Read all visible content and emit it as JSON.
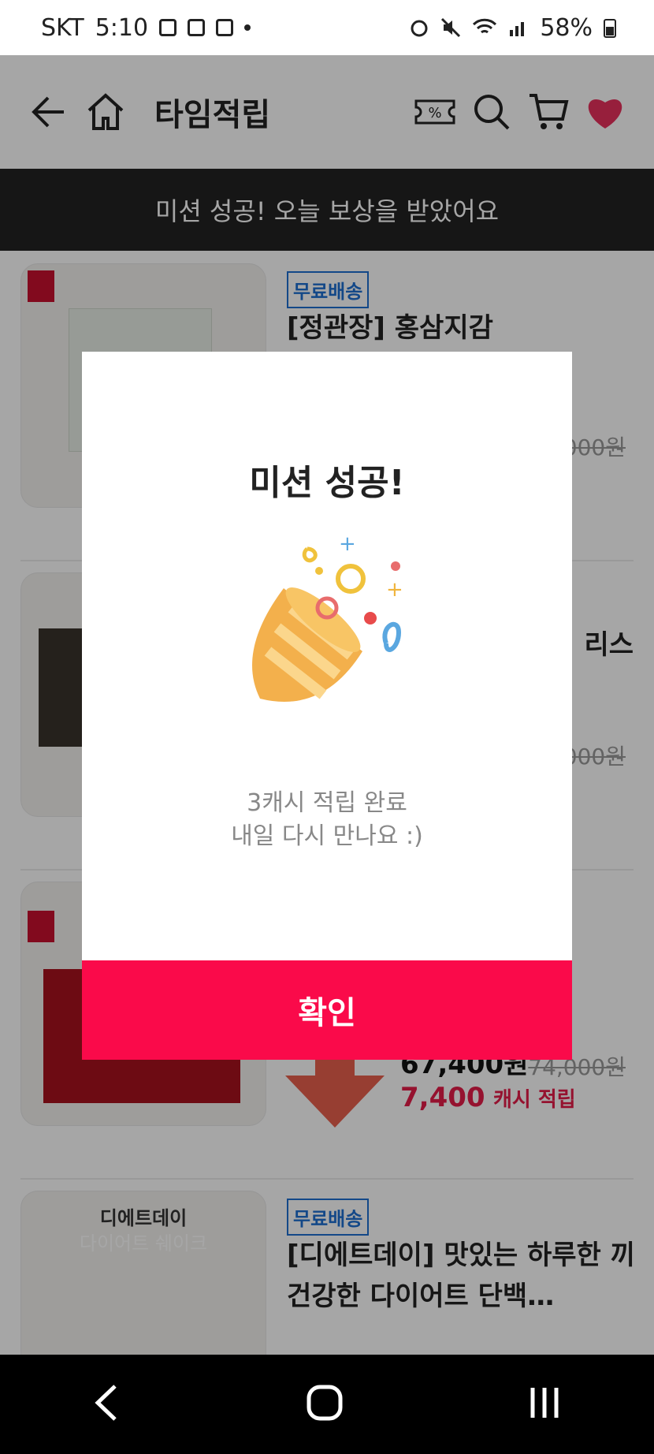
{
  "status_bar": {
    "carrier": "SKT",
    "time": "5:10",
    "battery": "58%"
  },
  "app_bar": {
    "title": "타임적립",
    "icons": [
      "back-arrow-icon",
      "home-icon",
      "coupon-icon",
      "search-icon",
      "cart-icon",
      "heart-icon"
    ]
  },
  "banner": {
    "text": "미션 성공! 오늘 보상을 받았어요"
  },
  "products": [
    {
      "tag": "무료배송",
      "name": "[정관장] 홍삼지감",
      "original_price_suffix": "000원"
    },
    {
      "name_tail": "리스",
      "original_price_suffix": "000원"
    },
    {
      "price": "67,400원",
      "original_price": "74,000원",
      "reward_amount": "7,400",
      "reward_label": "캐시 적립"
    },
    {
      "tag": "무료배송",
      "name": "[디에트데이] 맛있는 하루한 끼 건강한 다이어트 단백…",
      "thumb_text1": "디에트데이",
      "thumb_text2": "다이어트 쉐이크"
    }
  ],
  "modal": {
    "title": "미션 성공!",
    "message_line1": "3캐시 적립 완료",
    "message_line2": "내일 다시 만나요 :)",
    "confirm_label": "확인"
  },
  "colors": {
    "accent": "#fa0a4a",
    "banner_bg": "#222222",
    "tag_blue": "#1e6fd1",
    "reward_red": "#e51c49"
  }
}
